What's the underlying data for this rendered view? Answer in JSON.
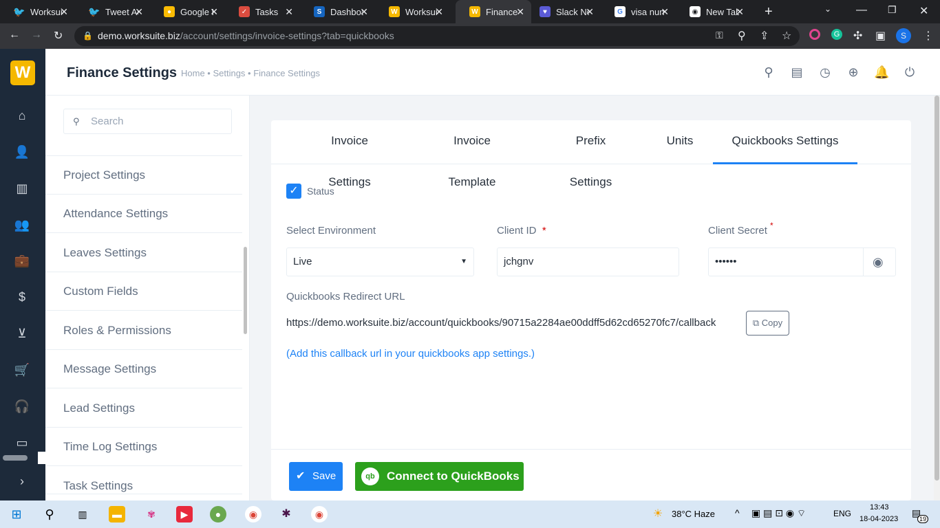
{
  "browser": {
    "tabs": [
      {
        "label": "Worksuite",
        "icon": "twitter-icon",
        "color": "#1d9bf0"
      },
      {
        "label": "Tweet Ac",
        "icon": "twitter-icon",
        "color": "#1d9bf0"
      },
      {
        "label": "Google K",
        "icon": "google-keep-icon",
        "color": "#fbbc04"
      },
      {
        "label": "Tasks",
        "icon": "todoist-icon",
        "color": "#db4c3f"
      },
      {
        "label": "Dashboa",
        "icon": "s-icon",
        "color": "#1565c0"
      },
      {
        "label": "Worksuit",
        "icon": "worksuite-icon",
        "color": "#f5b800"
      },
      {
        "label": "Finance",
        "icon": "worksuite-icon",
        "color": "#f5b800"
      },
      {
        "label": "Slack No",
        "icon": "slack-notes-icon",
        "color": "#5b5bd6"
      },
      {
        "label": "visa nun",
        "icon": "google-icon",
        "color": "#ffffff"
      },
      {
        "label": "New Tab",
        "icon": "chrome-icon",
        "color": "#ffffff"
      }
    ],
    "active_tab": 6,
    "url_host": "demo.worksuite.biz",
    "url_path": "/account/settings/invoice-settings?tab=quickbooks",
    "profile_initial": "S"
  },
  "header": {
    "title": "Finance Settings",
    "breadcrumb": "Home • Settings • Finance Settings"
  },
  "settings_nav": {
    "search_placeholder": "Search",
    "items": [
      "Project Settings",
      "Attendance Settings",
      "Leaves Settings",
      "Custom Fields",
      "Roles & Permissions",
      "Message Settings",
      "Lead Settings",
      "Time Log Settings",
      "Task Settings"
    ]
  },
  "tabs": [
    "Invoice Settings",
    "Invoice Template",
    "Prefix Settings",
    "Units",
    "Quickbooks Settings"
  ],
  "form": {
    "status_label": "Status",
    "status_checked": true,
    "env_label": "Select Environment",
    "env_value": "Live",
    "client_id_label": "Client ID",
    "client_id_value": "jchgnv",
    "client_secret_label": "Client Secret",
    "client_secret_value": "••••••",
    "required_mark": "*",
    "redirect_label": "Quickbooks Redirect URL",
    "redirect_url": "https://demo.worksuite.biz/account/quickbooks/90715a2284ae00ddff5d62cd65270fc7/callback",
    "copy_label": "Copy",
    "callback_hint": "(Add this callback url in your quickbooks app settings.)"
  },
  "footer": {
    "save_label": "Save",
    "connect_label": "Connect to QuickBooks",
    "qb_logo_text": "qb"
  },
  "taskbar": {
    "weather": "38°C  Haze",
    "language": "ENG",
    "time": "13:43",
    "date": "18-04-2023",
    "notifications": "19"
  },
  "colors": {
    "primary": "#1d82f5",
    "quickbooks": "#2ca01c",
    "sidebar": "#1d2a3a"
  }
}
